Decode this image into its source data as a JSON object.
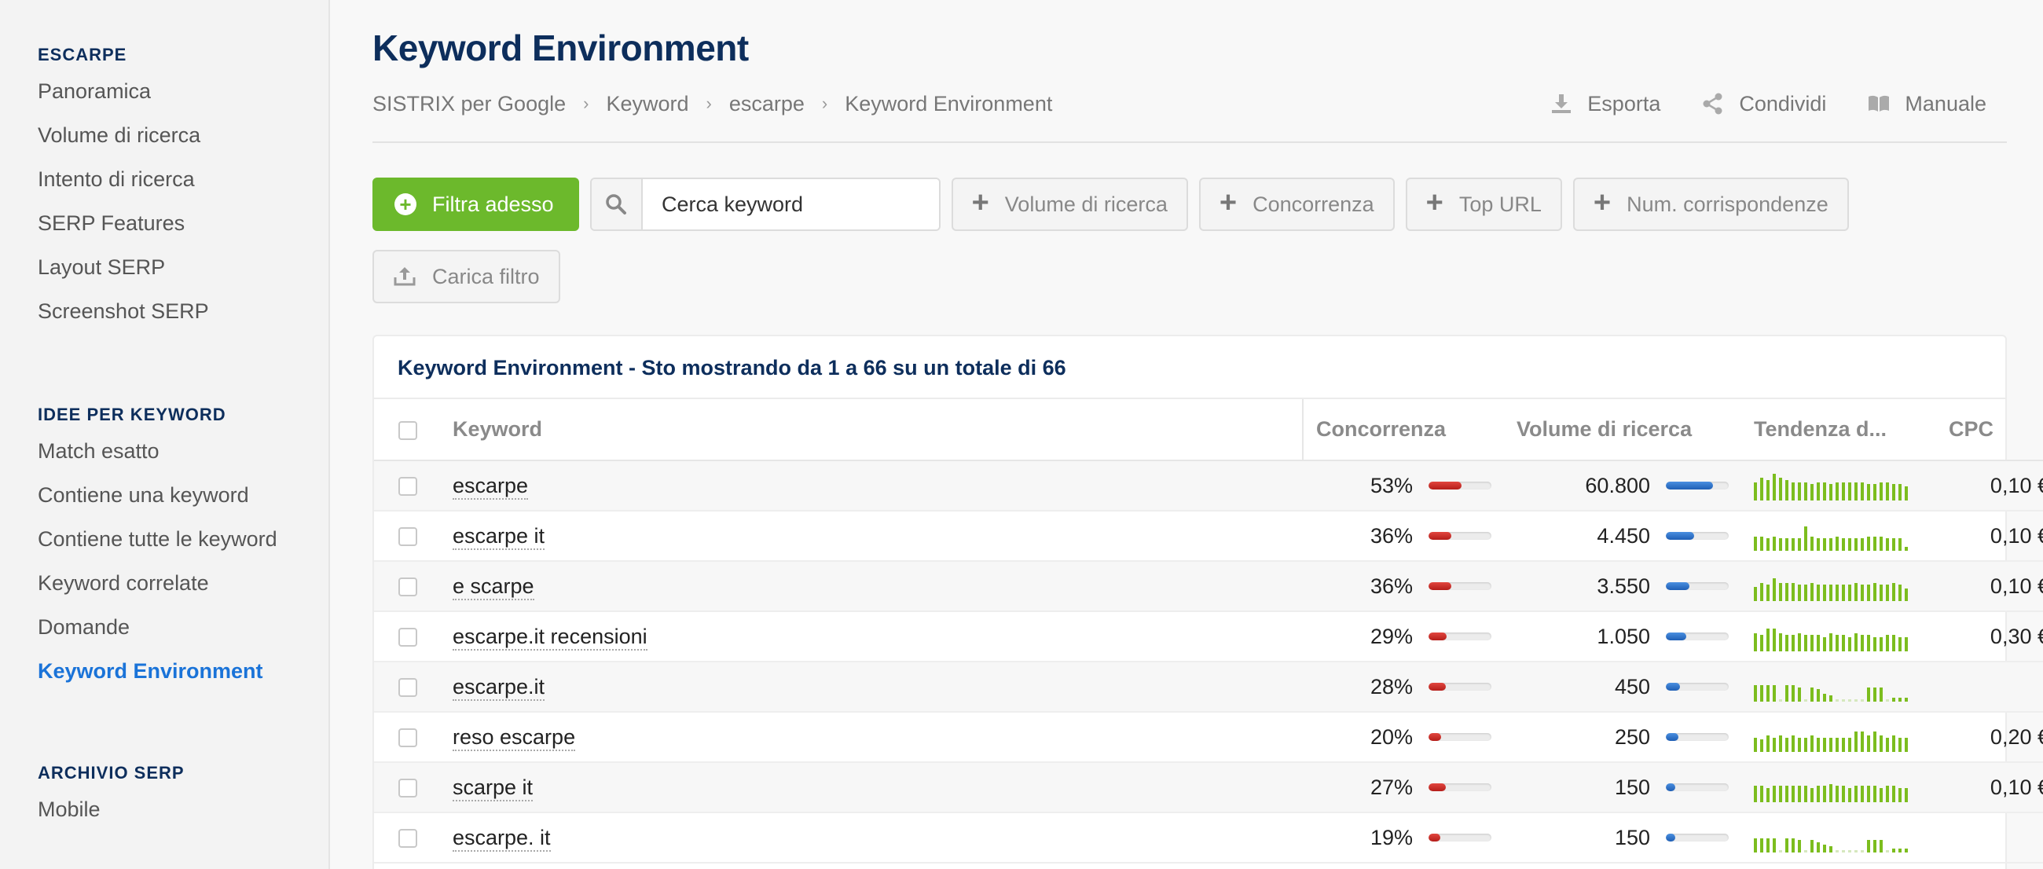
{
  "sidebar": {
    "sections": [
      {
        "heading": "ESCARPE",
        "items": [
          "Panoramica",
          "Volume di ricerca",
          "Intento di ricerca",
          "SERP Features",
          "Layout SERP",
          "Screenshot SERP"
        ]
      },
      {
        "heading": "IDEE PER KEYWORD",
        "items": [
          "Match esatto",
          "Contiene una keyword",
          "Contiene tutte le keyword",
          "Keyword correlate",
          "Domande",
          "Keyword Environment"
        ]
      },
      {
        "heading": "ARCHIVIO SERP",
        "items": [
          "Mobile"
        ]
      }
    ],
    "active_item": "Keyword Environment"
  },
  "header": {
    "title": "Keyword Environment",
    "breadcrumb": [
      "SISTRIX per Google",
      "Keyword",
      "escarpe",
      "Keyword Environment"
    ],
    "actions": {
      "export": "Esporta",
      "share": "Condividi",
      "manual": "Manuale"
    }
  },
  "filters": {
    "apply_label": "Filtra adesso",
    "search_placeholder": "Cerca keyword",
    "add_filters": [
      "Volume di ricerca",
      "Concorrenza",
      "Top URL",
      "Num. corrispondenze"
    ],
    "load_label": "Carica filtro"
  },
  "table": {
    "title": "Keyword Environment - Sto mostrando da 1 a 66 su un totale di 66",
    "columns": {
      "keyword": "Keyword",
      "competition": "Concorrenza",
      "volume": "Volume di ricerca",
      "trend": "Tendenza d...",
      "cpc": "CPC"
    },
    "rows": [
      {
        "keyword": "escarpe",
        "competition": "53%",
        "competition_pct": 53,
        "volume": "60.800",
        "volume_level": 0.75,
        "cpc": "0,10 €",
        "trend": [
          0.45,
          0.55,
          0.5,
          0.65,
          0.55,
          0.5,
          0.45,
          0.45,
          0.45,
          0.4,
          0.45,
          0.45,
          0.4,
          0.45,
          0.45,
          0.45,
          0.45,
          0.45,
          0.4,
          0.4,
          0.45,
          0.45,
          0.4,
          0.4,
          0.35
        ]
      },
      {
        "keyword": "escarpe it",
        "competition": "36%",
        "competition_pct": 36,
        "volume": "4.450",
        "volume_level": 0.45,
        "cpc": "0,10 €",
        "trend": [
          0.35,
          0.35,
          0.3,
          0.35,
          0.3,
          0.3,
          0.3,
          0.3,
          0.6,
          0.35,
          0.3,
          0.3,
          0.3,
          0.35,
          0.3,
          0.3,
          0.3,
          0.3,
          0.35,
          0.35,
          0.35,
          0.3,
          0.3,
          0.3,
          0.1
        ]
      },
      {
        "keyword": "e scarpe",
        "competition": "36%",
        "competition_pct": 36,
        "volume": "3.550",
        "volume_level": 0.38,
        "cpc": "0,10 €",
        "trend": [
          0.35,
          0.45,
          0.4,
          0.55,
          0.45,
          0.45,
          0.45,
          0.4,
          0.4,
          0.45,
          0.4,
          0.4,
          0.4,
          0.4,
          0.4,
          0.4,
          0.45,
          0.4,
          0.4,
          0.45,
          0.4,
          0.4,
          0.45,
          0.4,
          0.3
        ]
      },
      {
        "keyword": "escarpe.it recensioni",
        "competition": "29%",
        "competition_pct": 29,
        "volume": "1.050",
        "volume_level": 0.32,
        "cpc": "0,30 €",
        "trend": [
          0.45,
          0.4,
          0.55,
          0.55,
          0.45,
          0.4,
          0.4,
          0.45,
          0.4,
          0.4,
          0.4,
          0.35,
          0.45,
          0.4,
          0.4,
          0.35,
          0.45,
          0.4,
          0.4,
          0.35,
          0.35,
          0.4,
          0.4,
          0.35,
          0.35
        ]
      },
      {
        "keyword": "escarpe.it",
        "competition": "28%",
        "competition_pct": 28,
        "volume": "450",
        "volume_level": 0.22,
        "cpc": "-",
        "trend": [
          0.4,
          0.4,
          0.4,
          0.4,
          0.05,
          0.4,
          0.4,
          0.35,
          0.05,
          0.35,
          0.3,
          0.2,
          0.15,
          0.05,
          0.05,
          0.05,
          0.05,
          0.05,
          0.35,
          0.35,
          0.35,
          0.05,
          0.1,
          0.1,
          0.1
        ]
      },
      {
        "keyword": "reso escarpe",
        "competition": "20%",
        "competition_pct": 20,
        "volume": "250",
        "volume_level": 0.2,
        "cpc": "0,20 €",
        "trend": [
          0.35,
          0.3,
          0.4,
          0.35,
          0.4,
          0.35,
          0.4,
          0.35,
          0.35,
          0.4,
          0.35,
          0.35,
          0.35,
          0.35,
          0.35,
          0.35,
          0.5,
          0.5,
          0.4,
          0.5,
          0.4,
          0.35,
          0.4,
          0.35,
          0.35
        ]
      },
      {
        "keyword": "scarpe it",
        "competition": "27%",
        "competition_pct": 27,
        "volume": "150",
        "volume_level": 0.15,
        "cpc": "0,10 €",
        "trend": [
          0.4,
          0.4,
          0.35,
          0.4,
          0.4,
          0.4,
          0.4,
          0.4,
          0.4,
          0.35,
          0.4,
          0.4,
          0.45,
          0.4,
          0.4,
          0.35,
          0.4,
          0.4,
          0.4,
          0.4,
          0.35,
          0.4,
          0.4,
          0.35,
          0.35
        ]
      },
      {
        "keyword": "escarpe. it",
        "competition": "19%",
        "competition_pct": 19,
        "volume": "150",
        "volume_level": 0.15,
        "cpc": "-",
        "trend": [
          0.35,
          0.35,
          0.35,
          0.35,
          0.05,
          0.35,
          0.35,
          0.3,
          0.05,
          0.3,
          0.25,
          0.2,
          0.15,
          0.05,
          0.05,
          0.05,
          0.05,
          0.05,
          0.3,
          0.3,
          0.3,
          0.05,
          0.1,
          0.1,
          0.1
        ]
      }
    ]
  }
}
